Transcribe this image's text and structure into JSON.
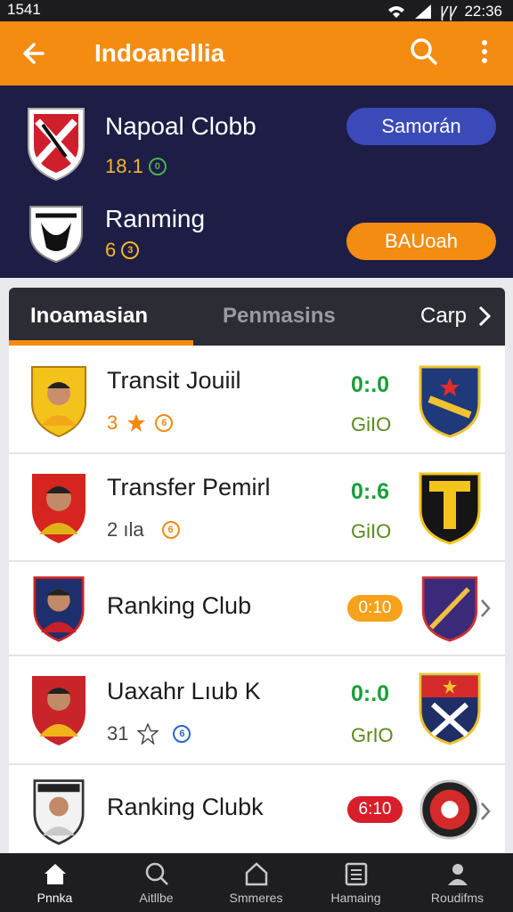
{
  "status": {
    "time_left": "1541",
    "time_right": "22:36",
    "right_icons": "ꝨꝨ"
  },
  "app_bar": {
    "title": "Indoanellia"
  },
  "hero": {
    "club1": {
      "name": "Napoal Clobb",
      "stat": "18.1",
      "coin": "0",
      "button": "Samorán"
    },
    "club2": {
      "name": "Ranming",
      "stat": "6",
      "coin": "3",
      "button": "BAUoah"
    }
  },
  "tabs": {
    "active": "Inoamasian",
    "second": "Penmasins",
    "third": "Carp"
  },
  "rows": [
    {
      "name": "Transit Jouiil",
      "meta": "3",
      "badge": "6",
      "score": "0:.0",
      "sub": "GiIO",
      "star": "filled"
    },
    {
      "name": "Transfer Pemirl",
      "meta": "2 ıla",
      "badge": "6",
      "score": "0:.6",
      "sub": "GiIO",
      "star": "none"
    },
    {
      "name": "Ranking Club",
      "pill": "0:10",
      "pill_color": "#f6a21a"
    },
    {
      "name": "Uaxahr Lıub K",
      "meta": "31",
      "badge": "6",
      "score": "0:.0",
      "sub": "GrIO",
      "star": "outline"
    },
    {
      "name": "Ranking Clubk",
      "pill": "6:10",
      "pill_color": "#d81e2a"
    }
  ],
  "nav": [
    {
      "label": "Pnnka",
      "icon": "home-icon"
    },
    {
      "label": "Aitllbe",
      "icon": "search-icon"
    },
    {
      "label": "Smmeres",
      "icon": "house-outline-icon"
    },
    {
      "label": "Hamaing",
      "icon": "calendar-icon"
    },
    {
      "label": "Roudifms",
      "icon": "person-icon"
    }
  ],
  "colors": {
    "accent": "#f48c12",
    "hero_bg": "#1d1d45",
    "tab_bg": "#2c2c34",
    "score_green": "#18a038"
  }
}
